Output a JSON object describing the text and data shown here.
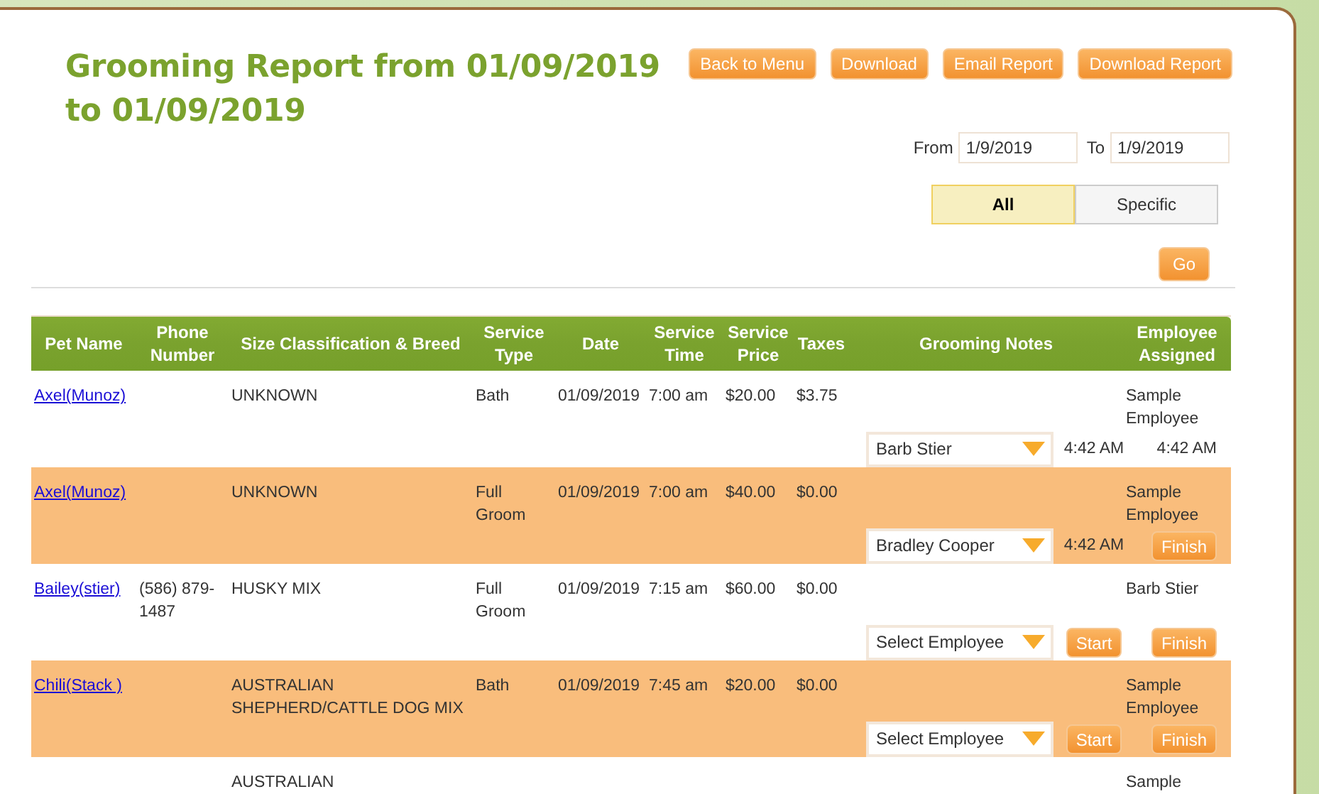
{
  "title": "Grooming Report from 01/09/2019 to 01/09/2019",
  "header_buttons": [
    "Back to Menu",
    "Download",
    "Email Report",
    "Download Report"
  ],
  "date_range": {
    "from_label": "From",
    "from_value": "1/9/2019",
    "to_label": "To",
    "to_value": "1/9/2019"
  },
  "filter_toggle": [
    {
      "label": "All",
      "selected": true
    },
    {
      "label": "Specific",
      "selected": false
    }
  ],
  "go_button": "Go",
  "table": {
    "columns": [
      "Pet Name",
      "Phone Number",
      "Size Classification & Breed",
      "Service Type",
      "Date",
      "Service Time",
      "Service Price",
      "Taxes",
      "Grooming Notes",
      "Employee Assigned"
    ],
    "rows": [
      {
        "pet": "Axel(Munoz)",
        "breed": "UNKNOWN",
        "service_type": "Bath",
        "date": "01/09/2019",
        "time": "7:00 am",
        "price": "$20.00",
        "taxes": "$3.75",
        "employee": "Sample Employee",
        "employee_select": "Barb Stier",
        "start": {
          "kind": "time",
          "text": "4:42 AM"
        },
        "finish": {
          "kind": "time",
          "text": "4:42 AM"
        }
      },
      {
        "pet": "Axel(Munoz)",
        "breed": "UNKNOWN",
        "service_type": "Full Groom",
        "date": "01/09/2019",
        "time": "7:00 am",
        "price": "$40.00",
        "taxes": "$0.00",
        "employee": "Sample Employee",
        "employee_select": "Bradley Cooper",
        "start": {
          "kind": "time",
          "text": "4:42 AM"
        },
        "finish": {
          "kind": "button",
          "text": "Finish"
        }
      },
      {
        "pet": "Bailey(stier)",
        "phone": "(586) 879-1487",
        "breed": "HUSKY MIX",
        "service_type": "Full Groom",
        "date": "01/09/2019",
        "time": "7:15 am",
        "price": "$60.00",
        "taxes": "$0.00",
        "employee": "Barb Stier",
        "employee_select": "Select Employee",
        "start": {
          "kind": "button",
          "text": "Start"
        },
        "finish": {
          "kind": "button",
          "text": "Finish"
        }
      },
      {
        "pet": "Chili(Stack )",
        "breed": "AUSTRALIAN SHEPHERD/CATTLE DOG MIX",
        "service_type": "Bath",
        "date": "01/09/2019",
        "time": "7:45 am",
        "price": "$20.00",
        "taxes": "$0.00",
        "employee": "Sample Employee",
        "employee_select": "Select Employee",
        "start": {
          "kind": "button",
          "text": "Start"
        },
        "finish": {
          "kind": "button",
          "text": "Finish"
        }
      },
      {
        "breed": "AUSTRALIAN",
        "employee": "Sample"
      }
    ]
  }
}
